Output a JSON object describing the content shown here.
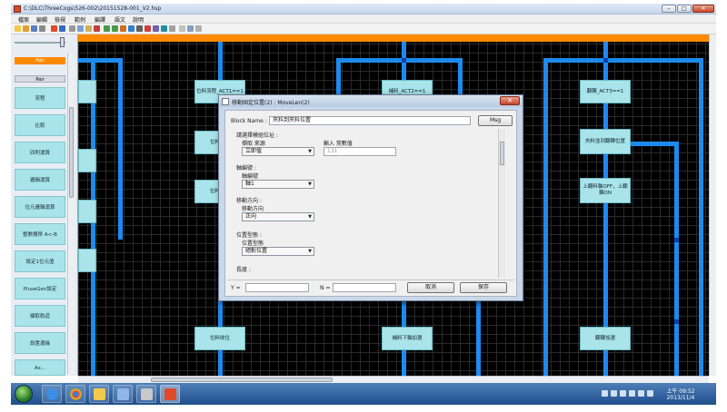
{
  "window": {
    "title": "C:\\DLC\\ThreeCogs\\526-002\\20151528-001_V2.hsp",
    "minimize": "–",
    "maximize": "□",
    "close": "✕"
  },
  "menu": [
    "檔案",
    "編輯",
    "檢視",
    "範例",
    "編譯",
    "語文",
    "說明"
  ],
  "palette": {
    "tabs": [
      "Pair",
      "Pair"
    ],
    "items": [
      "流程",
      "比較",
      "四則運算",
      "邏輯運算",
      "位元邏輯運算",
      "整數搬移 A<-B",
      "設定1位元值",
      "PluseGen設定",
      "擷取軌道",
      "設置邊緣",
      "Ax..."
    ]
  },
  "canvas": {
    "nodes": [
      "位料流程_ACT1==1",
      "位料夾緊",
      "位料加選",
      "補料_ACT2==1",
      "翻轉_ACT3==1",
      "夾料並到翻轉位置",
      "上翻料軸OFF，上翻轉ON",
      "位料收位",
      "補料下軸加選",
      "翻轉加選"
    ]
  },
  "dialog": {
    "title": "移動固定位置(2) : MoveLen(2)",
    "block_name_label": "Block Name :",
    "block_name_value": "夾料到夾料位置",
    "msg_button": "Msg",
    "section_location": "請選擇模組位址 :",
    "source_label": "擷取 來源",
    "source_value": "立即值",
    "input_label": "輸入 常數值",
    "input_value": "131",
    "section_axis": "軸編號 :",
    "axis_label": "軸編號",
    "axis_value": "軸1",
    "section_direction": "移動方向 :",
    "direction_label": "移動方向",
    "direction_value": "正向",
    "section_position": "位置型態 :",
    "position_label": "位置型態",
    "position_value": "絕對位置",
    "section_length": "長度 :",
    "y_label": "Y =",
    "n_label": "N =",
    "cancel_button": "取消",
    "save_button": "保存"
  },
  "taskbar": {
    "time": "上午 09:52",
    "date": "2013/11/4"
  },
  "colors": {
    "canvas_bg": "#000000",
    "flow_bar": "#1d8af0",
    "node_fill": "#a8e4ea",
    "header_bar": "#ff8a00"
  }
}
